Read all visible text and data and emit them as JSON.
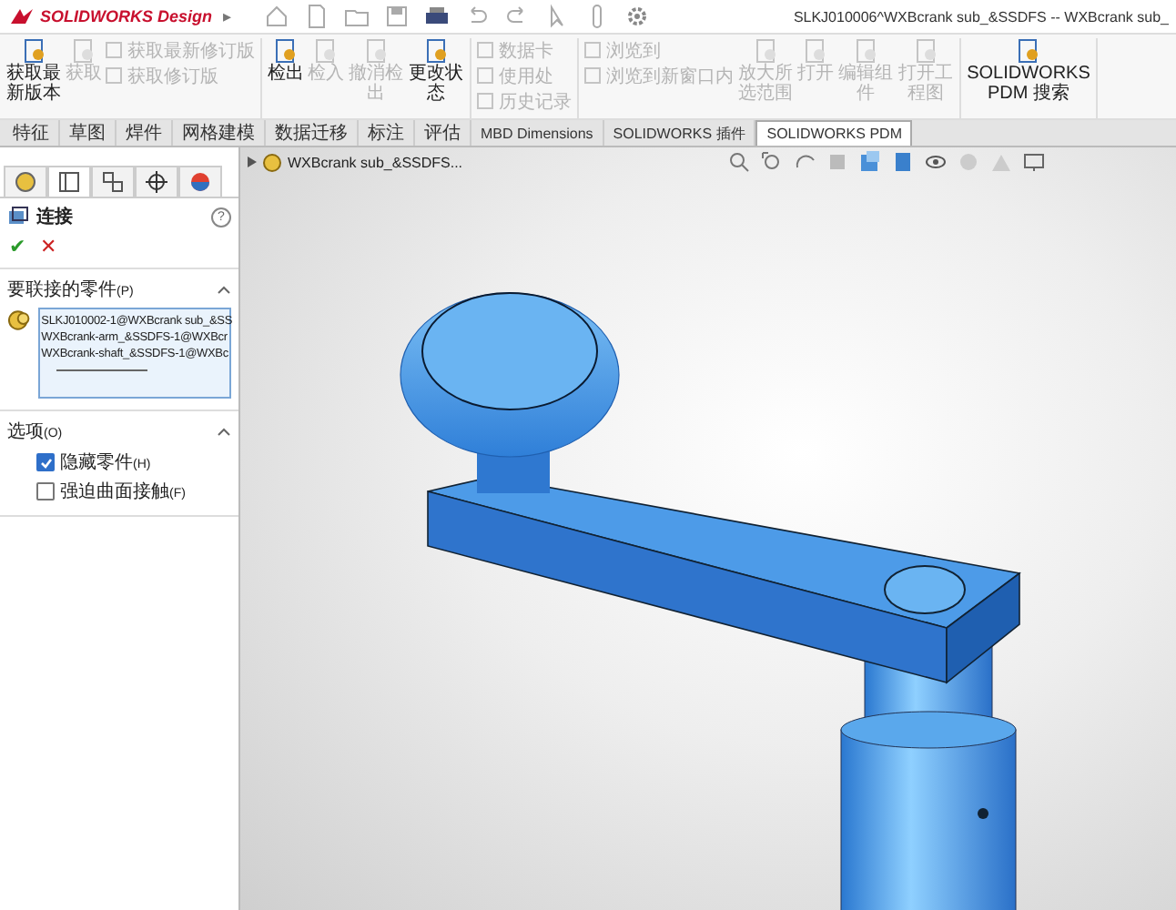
{
  "title_bar": {
    "logo": "SOLIDWORKS Design",
    "expand": "▸",
    "title": "SLKJ010006^WXBcrank sub_&SSDFS -- WXBcrank sub_"
  },
  "ribbon": {
    "groups": [
      {
        "items": [
          {
            "kind": "large",
            "label": "获取最新版本",
            "disabled": false
          },
          {
            "kind": "large",
            "label": "获取",
            "disabled": true
          },
          {
            "kind": "small",
            "label": "获取最新修订版",
            "disabled": true
          },
          {
            "kind": "small",
            "label": "获取修订版",
            "disabled": true
          }
        ]
      },
      {
        "items": [
          {
            "kind": "large",
            "label": "检出",
            "disabled": false
          },
          {
            "kind": "large",
            "label": "检入",
            "disabled": true
          },
          {
            "kind": "large",
            "label": "撤消检出",
            "disabled": true
          },
          {
            "kind": "large",
            "label": "更改状态",
            "disabled": false
          }
        ]
      },
      {
        "items": [
          {
            "kind": "small",
            "label": "数据卡",
            "disabled": true
          },
          {
            "kind": "small",
            "label": "使用处",
            "disabled": true
          },
          {
            "kind": "small",
            "label": "历史记录",
            "disabled": true
          }
        ]
      },
      {
        "items": [
          {
            "kind": "small",
            "label": "浏览到",
            "disabled": true
          },
          {
            "kind": "small",
            "label": "浏览到新窗口内",
            "disabled": true
          },
          {
            "kind": "large",
            "label": "放大所选范围",
            "disabled": true
          },
          {
            "kind": "large",
            "label": "打开",
            "disabled": true
          },
          {
            "kind": "large",
            "label": "编辑组件",
            "disabled": true
          },
          {
            "kind": "large",
            "label": "打开工程图",
            "disabled": true
          }
        ]
      },
      {
        "items": [
          {
            "kind": "large",
            "label": "SOLIDWORKS PDM 搜索",
            "disabled": false
          }
        ]
      }
    ]
  },
  "tabs": [
    {
      "label": "特征",
      "selected": false
    },
    {
      "label": "草图",
      "selected": false
    },
    {
      "label": "焊件",
      "selected": false
    },
    {
      "label": "网格建模",
      "selected": false
    },
    {
      "label": "数据迁移",
      "selected": false
    },
    {
      "label": "标注",
      "selected": false
    },
    {
      "label": "评估",
      "selected": false
    },
    {
      "label": "MBD Dimensions",
      "selected": false
    },
    {
      "label": "SOLIDWORKS 插件",
      "selected": false
    },
    {
      "label": "SOLIDWORKS PDM",
      "selected": true
    }
  ],
  "panel": {
    "title": "连接",
    "help": "?",
    "ok": "✔",
    "cancel": "✕",
    "sections": [
      {
        "kind": "list",
        "title": "要联接的零件",
        "accel": "(P)",
        "expanded": true,
        "items": [
          "SLKJ010002-1@WXBcrank sub_&SS",
          "WXBcrank-arm_&SSDFS-1@WXBcr",
          "WXBcrank-shaft_&SSDFS-1@WXBc"
        ]
      },
      {
        "kind": "options",
        "title": "选项",
        "accel": "(O)",
        "expanded": true,
        "options": [
          {
            "label": "隐藏零件",
            "accel": "(H)",
            "checked": true
          },
          {
            "label": "强迫曲面接触",
            "accel": "(F)",
            "checked": false
          }
        ]
      }
    ]
  },
  "viewport": {
    "tree_item": "WXBcrank sub_&SSDFS..."
  }
}
